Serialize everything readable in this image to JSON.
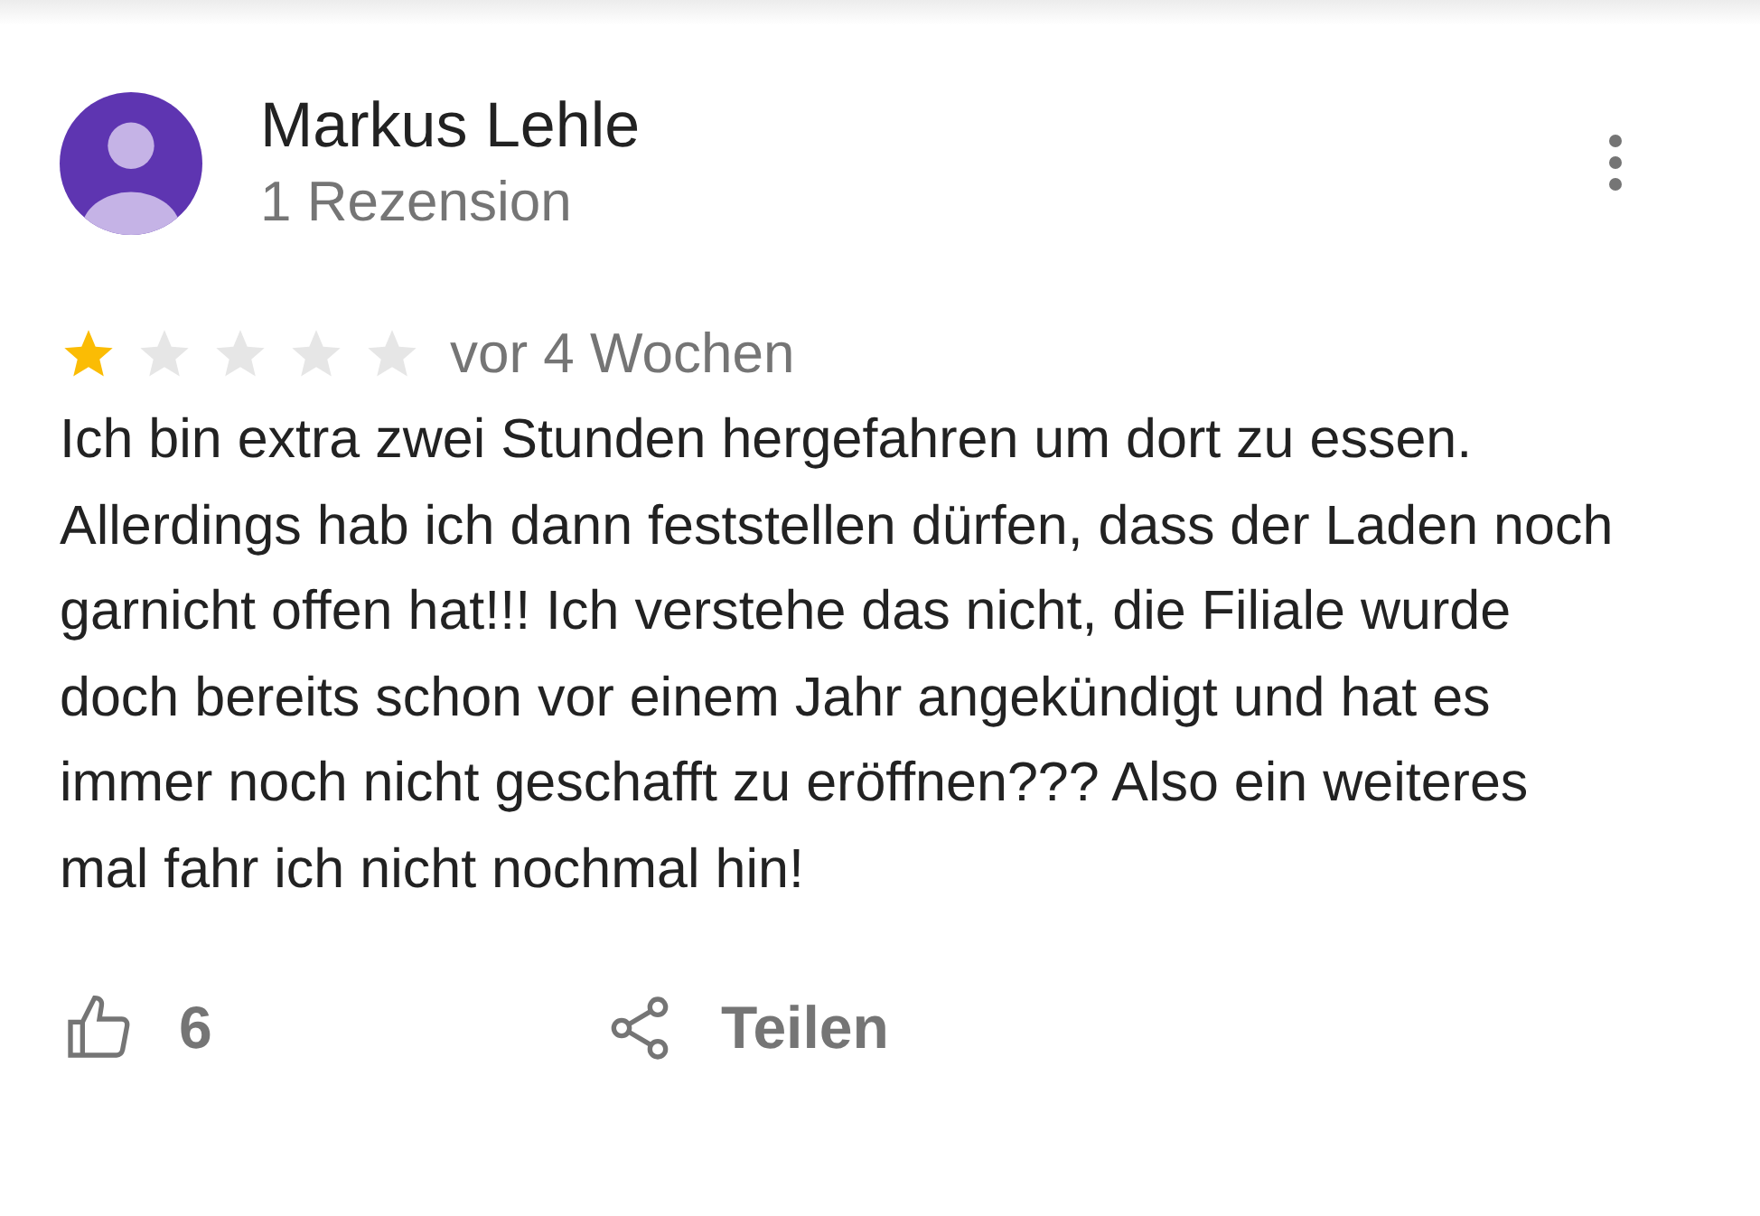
{
  "review": {
    "author": "Markus Lehle",
    "subtitle": "1 Rezension",
    "stars": 1,
    "time": "vor 4 Wochen",
    "text": "Ich bin extra zwei Stunden hergefahren um dort zu essen. Allerdings hab ich dann feststellen dürfen, dass der Laden noch garnicht offen hat!!! Ich verstehe das nicht, die Filiale wurde doch bereits schon vor einem Jahr angekündigt und hat es immer noch nicht geschafft zu eröffnen??? Also ein weiteres mal fahr ich nicht nochmal hin!",
    "likes": "6",
    "share_label": "Teilen"
  }
}
